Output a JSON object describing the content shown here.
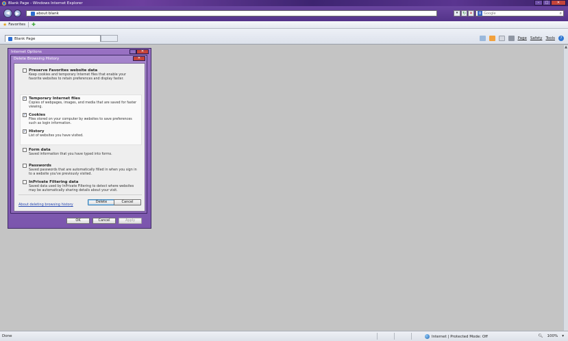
{
  "window": {
    "title": "Blank Page - Windows Internet Explorer"
  },
  "address_bar": {
    "url": "about:blank",
    "search_provider": "Google",
    "search_placeholder": "Google"
  },
  "favorites_bar": {
    "favorites_label": "Favorites"
  },
  "tab": {
    "label": "Blank Page"
  },
  "command_bar": {
    "page_label": "Page",
    "safety_label": "Safety",
    "tools_label": "Tools"
  },
  "internet_options": {
    "title": "Internet Options",
    "ok_label": "OK",
    "cancel_label": "Cancel",
    "apply_label": "Apply"
  },
  "delete_history": {
    "title": "Delete Browsing History",
    "items": [
      {
        "label": "Preserve Favorites website data",
        "checked": false,
        "desc": "Keep cookies and temporary Internet files that enable your favorite websites to retain preferences and display faster."
      },
      {
        "label": "Temporary Internet files",
        "checked": true,
        "desc": "Copies of webpages, images, and media that are saved for faster viewing."
      },
      {
        "label": "Cookies",
        "checked": true,
        "desc": "Files stored on your computer by websites to save preferences such as login information."
      },
      {
        "label": "History",
        "checked": true,
        "desc": "List of websites you have visited."
      },
      {
        "label": "Form data",
        "checked": false,
        "desc": "Saved information that you have typed into forms."
      },
      {
        "label": "Passwords",
        "checked": false,
        "desc": "Saved passwords that are automatically filled in when you sign in to a website you've previously visited."
      },
      {
        "label": "InPrivate Filtering data",
        "checked": false,
        "desc": "Saved data used by InPrivate Filtering to detect where websites may be automatically sharing details about your visit."
      }
    ],
    "about_link": "About deleting browsing history",
    "delete_label": "Delete",
    "cancel_label": "Cancel"
  },
  "status_bar": {
    "status": "Done",
    "zone": "Internet | Protected Mode: Off",
    "zoom": "100%"
  },
  "colors": {
    "title_bar": "#4b2a83",
    "dialog_frame": "#9871c2",
    "close_button": "#c6433a"
  }
}
